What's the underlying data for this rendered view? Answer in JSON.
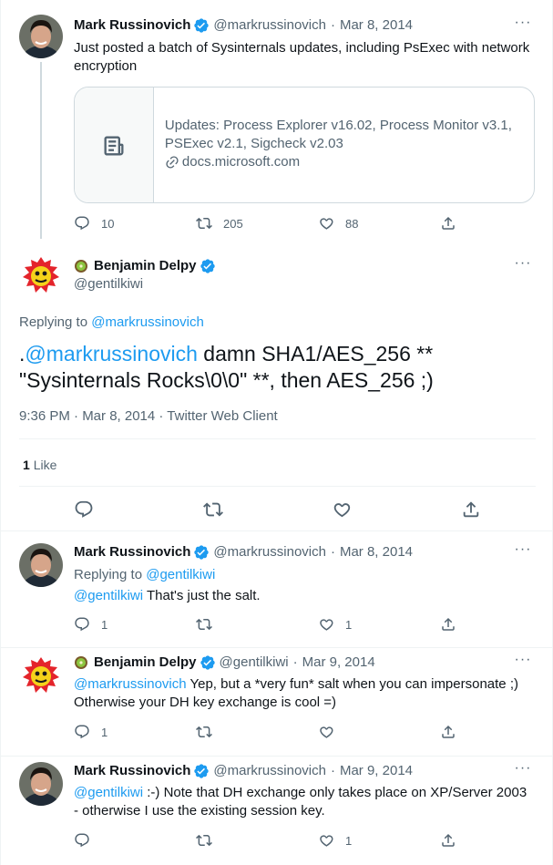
{
  "colors": {
    "accent": "#1d9bf0",
    "text": "#0f1419",
    "muted": "#536471",
    "line": "#cfd9de"
  },
  "tweet1": {
    "name": "Mark Russinovich",
    "handle": "@markrussinovich",
    "date": "Mar 8, 2014",
    "text": "Just posted a batch of Sysinternals updates, including PsExec with network encryption",
    "card": {
      "title": "Updates: Process Explorer v16.02, Process Monitor v3.1, PSExec v2.1, Sigcheck v2.03",
      "domain": "docs.microsoft.com",
      "icon": "document-icon"
    },
    "replies": "10",
    "retweets": "205",
    "likes": "88"
  },
  "main": {
    "name": "Benjamin Delpy",
    "handle": "@gentilkiwi",
    "replying_label": "Replying to",
    "replying_to": "@markrussinovich",
    "text_prefix": ".",
    "mention": "@markrussinovich",
    "text_rest": " damn SHA1/AES_256 ** \"Sysinternals Rocks\\0\\0\" **, then AES_256 ;)",
    "meta": "9:36 PM · Mar 8, 2014 · Twitter Web Client",
    "likes_count": "1",
    "likes_label": "Like"
  },
  "reply1": {
    "name": "Mark Russinovich",
    "handle": "@markrussinovich",
    "date": "Mar 8, 2014",
    "replying_label": "Replying to",
    "replying_to": "@gentilkiwi",
    "mention": "@gentilkiwi",
    "text": " That's just the salt.",
    "replies": "1",
    "retweets": "",
    "likes": "1"
  },
  "reply2": {
    "name": "Benjamin Delpy",
    "handle": "@gentilkiwi",
    "date": "Mar 9, 2014",
    "mention": "@markrussinovich",
    "text": " Yep, but a *very fun* salt when you can impersonate ;) Otherwise your DH key exchange is cool =)",
    "replies": "1",
    "retweets": "",
    "likes": ""
  },
  "reply3": {
    "name": "Mark Russinovich",
    "handle": "@markrussinovich",
    "date": "Mar 9, 2014",
    "mention": "@gentilkiwi",
    "text": " :-) Note that DH exchange only takes place on XP/Server 2003 - otherwise I use the existing session key.",
    "replies": "",
    "retweets": "",
    "likes": "1"
  },
  "dot": "·",
  "more": "···"
}
